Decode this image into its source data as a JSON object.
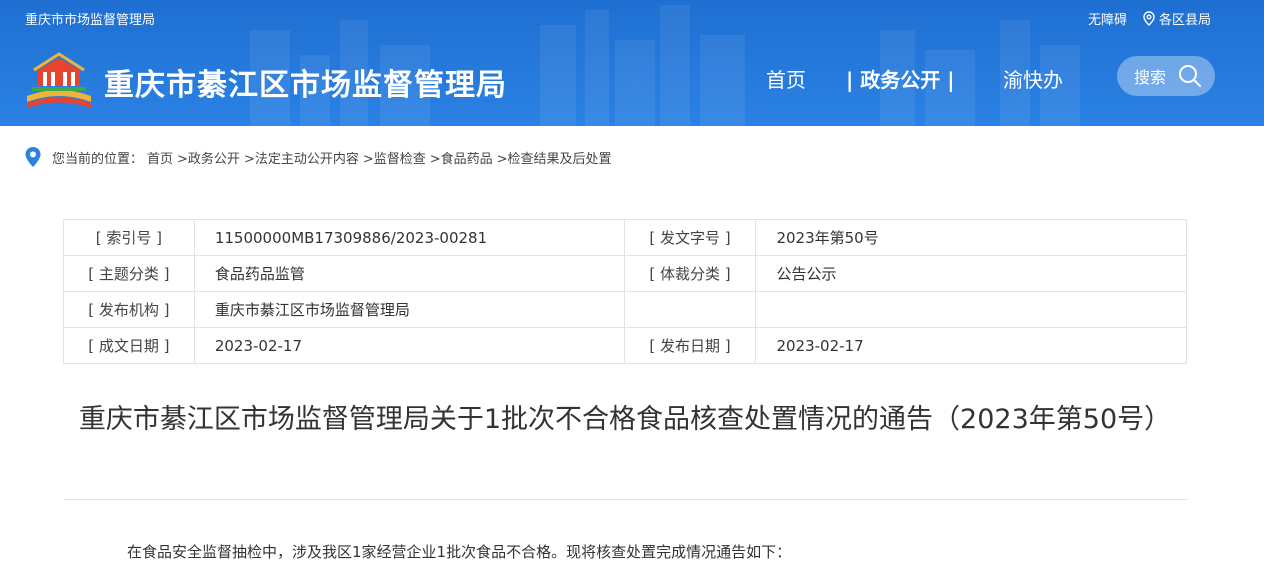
{
  "header": {
    "top_left": "重庆市市场监督管理局",
    "accessibility": "无障碍",
    "districts": "各区县局",
    "site_title": "重庆市綦江区市场监督管理局",
    "nav": {
      "home": "首页",
      "gov_public": "| 政务公开 |",
      "yukuaiban": "渝快办"
    },
    "search_label": "搜索",
    "colors": {
      "header_bg": "#2b82e4"
    }
  },
  "breadcrumb": {
    "prefix": "您当前的位置：",
    "items": [
      "首页",
      ">政务公开",
      ">法定主动公开内容",
      ">监督检查",
      ">食品药品",
      ">检查结果及后处置"
    ]
  },
  "meta": {
    "index_no_label": "[ 索引号 ]",
    "index_no": "11500000MB17309886/2023-00281",
    "doc_no_label": "[ 发文字号 ]",
    "doc_no": "2023年第50号",
    "topic_label": "[ 主题分类 ]",
    "topic": "食品药品监管",
    "genre_label": "[ 体裁分类 ]",
    "genre": "公告公示",
    "publisher_label": "[ 发布机构 ]",
    "publisher": "重庆市綦江区市场监督管理局",
    "written_label": "[ 成文日期 ]",
    "written_date": "2023-02-17",
    "published_label": "[ 发布日期 ]",
    "published_date": "2023-02-17"
  },
  "article": {
    "title": "重庆市綦江区市场监督管理局关于1批次不合格食品核查处置情况的通告（2023年第50号）",
    "paragraph1": "在食品安全监督抽检中，涉及我区1家经营企业1批次食品不合格。现将核查处置完成情况通告如下："
  }
}
